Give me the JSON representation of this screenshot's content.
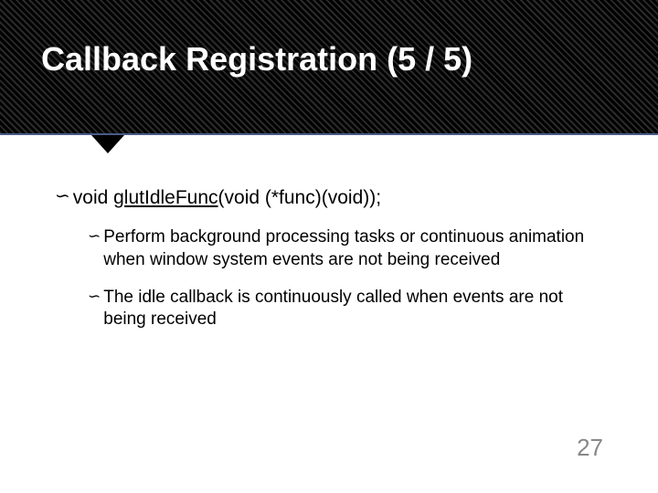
{
  "header": {
    "title": "Callback Registration (5 / 5)"
  },
  "main": {
    "prefix": "void ",
    "funcName": "glutIdleFunc",
    "signature": "(void (*func)(void));"
  },
  "bullets": [
    {
      "text": "Perform background processing tasks or continuous animation when window system events are not being received"
    },
    {
      "text": "The idle callback is continuously called when events are not being received"
    }
  ],
  "pageNumber": "27"
}
